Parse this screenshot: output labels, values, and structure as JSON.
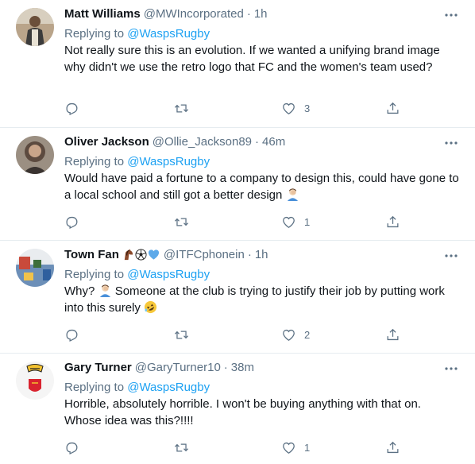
{
  "replying_label": "Replying to",
  "icons": {
    "more": "more-horizontal-icon",
    "reply": "reply-icon",
    "retweet": "retweet-icon",
    "like": "heart-icon",
    "share": "share-icon"
  },
  "colors": {
    "link": "#1da1f2",
    "secondary": "#5b7083",
    "text": "#0f1419",
    "divider": "#e6ecf0"
  },
  "tweets": [
    {
      "name": "Matt Williams",
      "handle": "@MWIncorporated",
      "separator": "·",
      "time": "1h",
      "mention": "@WaspsRugby",
      "text": "Not really sure this is an evolution. If we wanted a unifying brand image why didn't we use the retro logo that FC and the women's team used?",
      "likes": "3"
    },
    {
      "name": "Oliver Jackson",
      "handle": "@Ollie_Jackson89",
      "separator": "·",
      "time": "46m",
      "mention": "@WaspsRugby",
      "text": "Would have paid a fortune to a company to design this, could have gone to a local school and still got a better design",
      "text_emoji": "man-facepalming",
      "likes": "1"
    },
    {
      "name": "Town Fan",
      "name_emojis": [
        "horse",
        "soccer-ball",
        "blue-heart"
      ],
      "handle": "@ITFCphonein",
      "separator": "·",
      "time": "1h",
      "mention": "@WaspsRugby",
      "text_a": "Why?",
      "text_a_emoji": "man-facepalming",
      "text_b": "Someone at the club is trying to justify their job by putting work into this surely",
      "text_b_emoji": "rolling-on-the-floor-laughing",
      "likes": "2"
    },
    {
      "name": "Gary Turner",
      "handle": "@GaryTurner10",
      "separator": "·",
      "time": "38m",
      "mention": "@WaspsRugby",
      "text": "Horrible, absolutely horrible. I won't be buying anything with that on. Whose idea was this?!!!!",
      "likes": "1"
    }
  ]
}
